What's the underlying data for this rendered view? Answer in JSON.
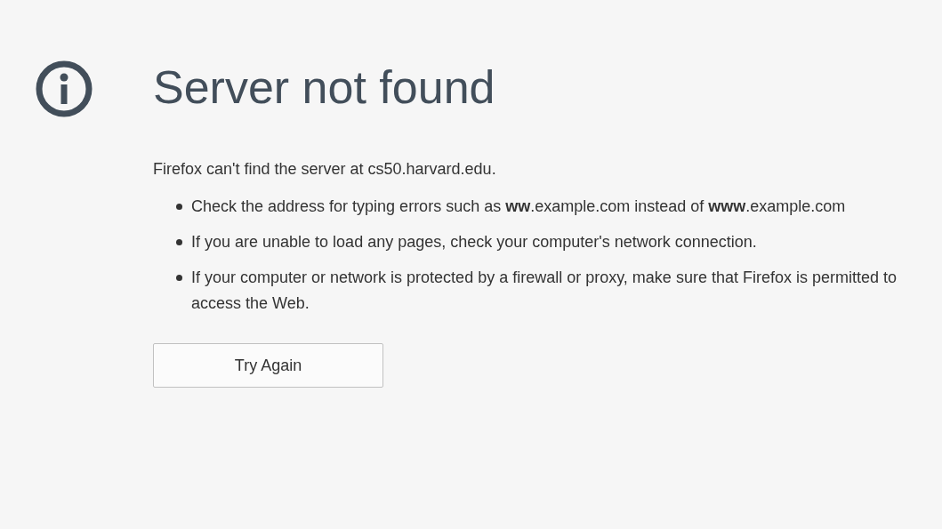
{
  "title": "Server not found",
  "description": "Firefox can't find the server at cs50.harvard.edu.",
  "suggestions": [
    "Check the address for typing errors such as **ww**.example.com instead of **www**.example.com",
    "If you are unable to load any pages, check your computer's network connection.",
    "If your computer or network is protected by a firewall or proxy, make sure that Firefox is permitted to access the Web."
  ],
  "button": "Try Again"
}
